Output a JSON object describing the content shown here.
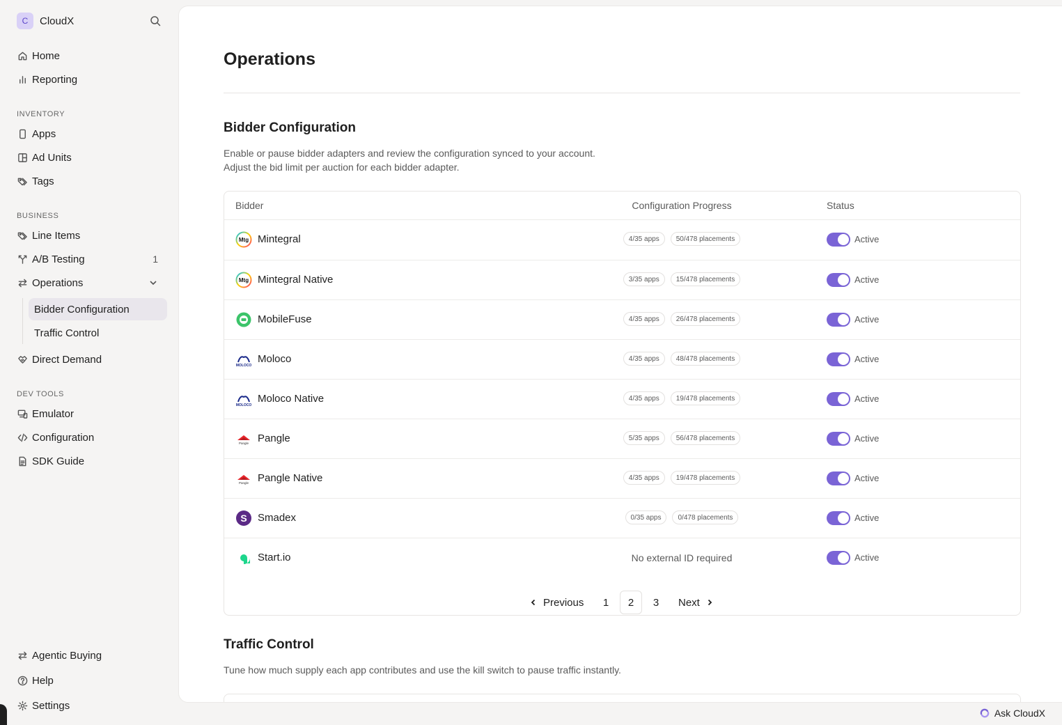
{
  "app": {
    "logo_letter": "C",
    "name": "CloudX"
  },
  "sidebar": {
    "home": "Home",
    "reporting": "Reporting",
    "inventory_label": "INVENTORY",
    "apps": "Apps",
    "ad_units": "Ad Units",
    "tags": "Tags",
    "business_label": "BUSINESS",
    "line_items": "Line Items",
    "ab_testing": "A/B Testing",
    "ab_testing_count": "1",
    "operations": "Operations",
    "bidder_configuration": "Bidder Configuration",
    "traffic_control": "Traffic Control",
    "direct_demand": "Direct Demand",
    "devtools_label": "DEV TOOLS",
    "emulator": "Emulator",
    "configuration": "Configuration",
    "sdk_guide": "SDK Guide",
    "agentic_buying": "Agentic Buying",
    "help": "Help",
    "settings": "Settings"
  },
  "page": {
    "title": "Operations",
    "bidder_section": {
      "title": "Bidder Configuration",
      "desc_line1": "Enable or pause bidder adapters and review the configuration synced to your account.",
      "desc_line2": "Adjust the bid limit per auction for each bidder adapter."
    },
    "table": {
      "col_bidder": "Bidder",
      "col_progress": "Configuration Progress",
      "col_status": "Status",
      "rows": [
        {
          "name": "Mintegral",
          "apps": "4/35 apps",
          "placements": "50/478 placements",
          "status": "Active",
          "logo": "mintegral-logo"
        },
        {
          "name": "Mintegral Native",
          "apps": "3/35 apps",
          "placements": "15/478 placements",
          "status": "Active",
          "logo": "mintegral-logo"
        },
        {
          "name": "MobileFuse",
          "apps": "4/35 apps",
          "placements": "26/478 placements",
          "status": "Active",
          "logo": "mobilefuse-logo"
        },
        {
          "name": "Moloco",
          "apps": "4/35 apps",
          "placements": "48/478 placements",
          "status": "Active",
          "logo": "moloco-logo"
        },
        {
          "name": "Moloco Native",
          "apps": "4/35 apps",
          "placements": "19/478 placements",
          "status": "Active",
          "logo": "moloco-logo"
        },
        {
          "name": "Pangle",
          "apps": "5/35 apps",
          "placements": "56/478 placements",
          "status": "Active",
          "logo": "pangle-logo"
        },
        {
          "name": "Pangle Native",
          "apps": "4/35 apps",
          "placements": "19/478 placements",
          "status": "Active",
          "logo": "pangle-logo"
        },
        {
          "name": "Smadex",
          "apps": "0/35 apps",
          "placements": "0/478 placements",
          "status": "Active",
          "logo": "smadex-logo"
        },
        {
          "name": "Start.io",
          "no_external": "No external ID required",
          "status": "Active",
          "logo": "startio-logo"
        }
      ]
    },
    "pager": {
      "previous": "Previous",
      "p1": "1",
      "p2": "2",
      "p3": "3",
      "next": "Next",
      "current_page": 2
    },
    "traffic_section": {
      "title": "Traffic Control",
      "desc": "Tune how much supply each app contributes and use the kill switch to pause traffic instantly."
    }
  },
  "ask": {
    "label": "Ask CloudX"
  },
  "colors": {
    "accent": "#7a64d6",
    "active_nav_bg": "#e9e6ec",
    "sidebar_bg": "#f5f4f3"
  }
}
